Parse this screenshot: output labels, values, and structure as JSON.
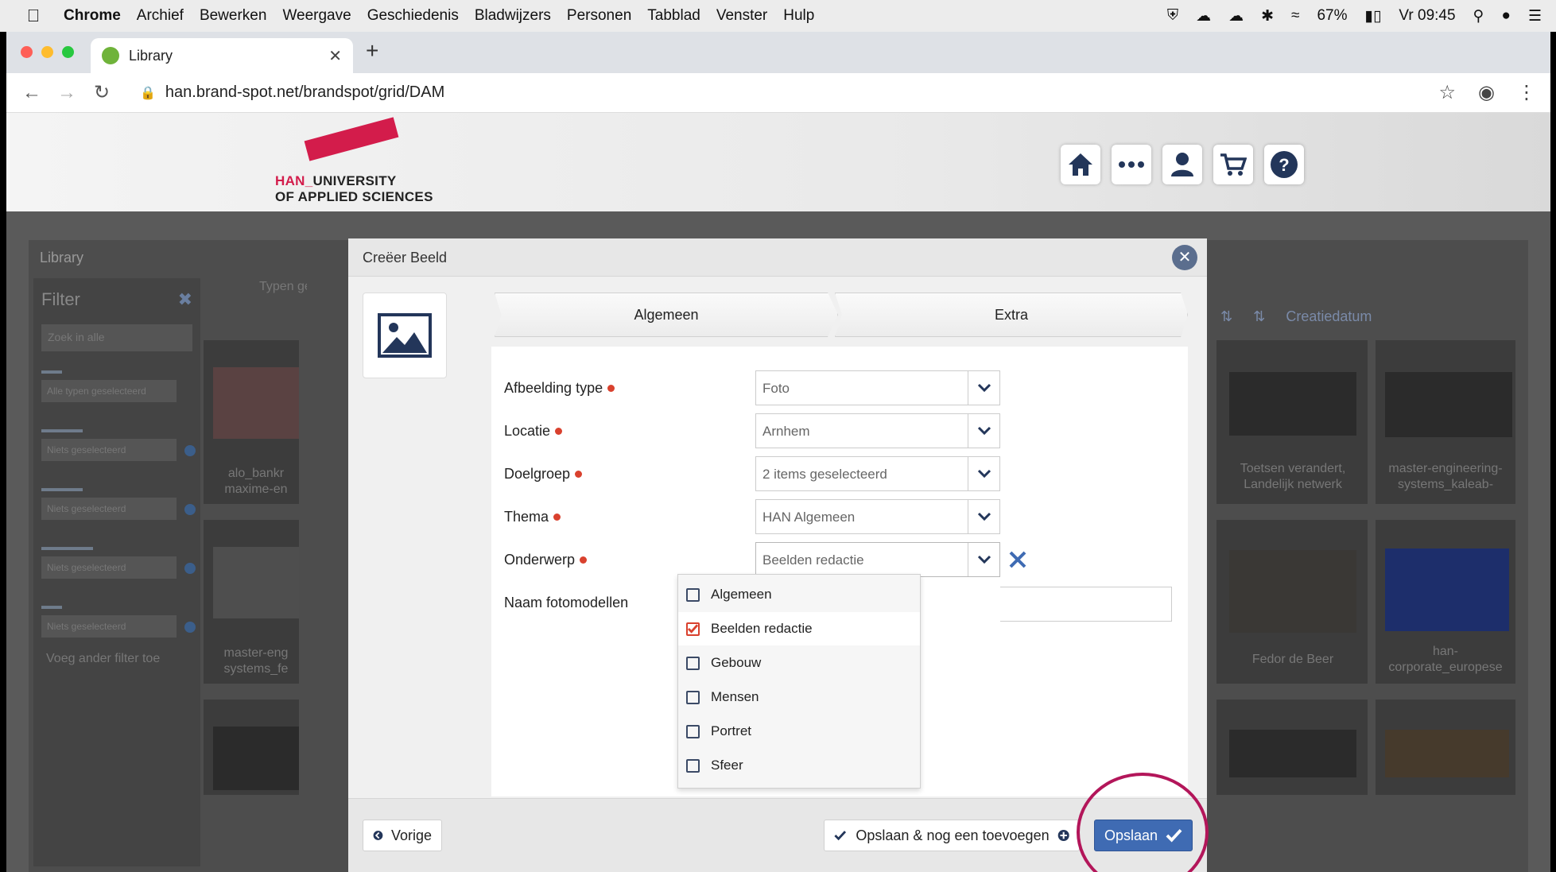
{
  "menubar": {
    "app": "Chrome",
    "items": [
      "Archief",
      "Bewerken",
      "Weergave",
      "Geschiedenis",
      "Bladwijzers",
      "Personen",
      "Tabblad",
      "Venster",
      "Hulp"
    ],
    "battery": "67%",
    "clock": "Vr 09:45"
  },
  "browser": {
    "tab_title": "Library",
    "url": "han.brand-spot.net/brandspot/grid/DAM"
  },
  "header": {
    "logo_han": "HAN_",
    "logo_line1": "UNIVERSITY",
    "logo_line2": "OF APPLIED SCIENCES"
  },
  "library": {
    "title": "Library",
    "filter_title": "Filter",
    "search_placeholder": "Zoek in alle",
    "types_label": "Typen geselecteerd",
    "all_types": "Alle typen geselecteerd",
    "none_selected": "Niets geselecteerd",
    "add_filter": "Voeg ander filter toe",
    "sort_label": "Creatiedatum",
    "thumb_captions": [
      "alo_bankr maxime-en",
      "master-eng systems_fe",
      "Toetsen verandert, Landelijk netwerk",
      "master-engineering-systems_kaleab-",
      "Fedor de Beer",
      "han-corporate_europese"
    ]
  },
  "modal": {
    "title": "Creëer Beeld",
    "tabs": [
      "Algemeen",
      "Extra"
    ],
    "fields": [
      {
        "label": "Afbeelding type",
        "value": "Foto"
      },
      {
        "label": "Locatie",
        "value": "Arnhem"
      },
      {
        "label": "Doelgroep",
        "value": "2 items geselecteerd"
      },
      {
        "label": "Thema",
        "value": "HAN Algemeen"
      },
      {
        "label": "Onderwerp",
        "value": "Beelden redactie"
      }
    ],
    "naam_label": "Naam fotomodellen",
    "dropdown_options": [
      "Algemeen",
      "Beelden redactie",
      "Gebouw",
      "Mensen",
      "Portret",
      "Sfeer"
    ],
    "checked_option": "Beelden redactie",
    "buttons": {
      "prev": "Vorige",
      "save_add": "Opslaan & nog een toevoegen",
      "save": "Opslaan"
    }
  },
  "colors": {
    "han_red": "#d31c4b",
    "primary_blue": "#3f6bb3",
    "required_dot": "#d9412e",
    "annotation_circle": "#b3165a"
  }
}
